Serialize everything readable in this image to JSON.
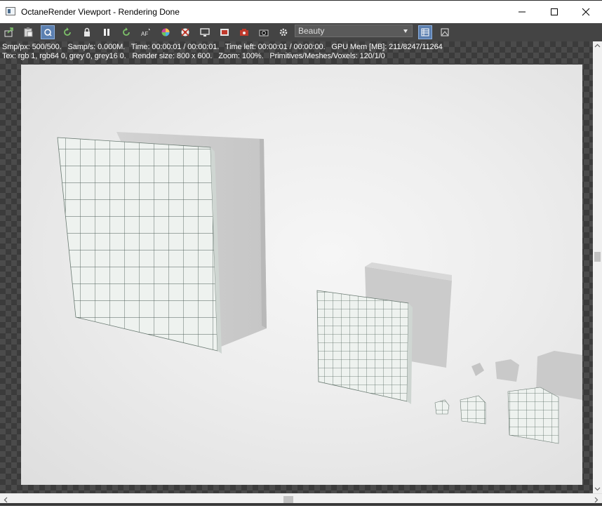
{
  "window": {
    "title": "OctaneRender Viewport - Rendering Done"
  },
  "toolbar": {
    "buttons": [
      {
        "icon": "send-scene-icon"
      },
      {
        "icon": "clipboard-icon"
      },
      {
        "icon": "zoom-q-icon",
        "active": true
      },
      {
        "icon": "restart-render-icon"
      },
      {
        "icon": "lock-icon"
      },
      {
        "icon": "pause-icon"
      },
      {
        "icon": "refresh-icon"
      },
      {
        "icon": "auto-focus-icon"
      },
      {
        "icon": "color-picker-icon"
      },
      {
        "icon": "material-picker-icon"
      },
      {
        "icon": "region-render-icon"
      },
      {
        "icon": "film-region-icon"
      },
      {
        "icon": "camera-red-icon"
      },
      {
        "icon": "snapshot-icon"
      },
      {
        "icon": "settings-gear-icon"
      }
    ],
    "render_pass": "Beauty",
    "right_buttons": [
      {
        "icon": "list-view-icon",
        "active": true
      },
      {
        "icon": "image-view-icon"
      }
    ]
  },
  "stats": {
    "line1": "Smp/px: 500/500.   Samp/s: 0.000M.   Time: 00:00:01 / 00:00:01.   Time left: 00:00:01 / 00:00:00.   GPU Mem [MB]: 211/8247/11264",
    "line2": "Tex: rgb 1, rgb64 0, grey 0, grey16 0.   Render size: 800 x 600.   Zoom: 100%.   Primitives/Meshes/Voxels: 120/1/0"
  },
  "colors": {
    "toolbar_bg": "#444444",
    "active_button": "#5b7fb0",
    "checker_dark": "#3b3b3b",
    "checker_light": "#4b4b4b"
  }
}
